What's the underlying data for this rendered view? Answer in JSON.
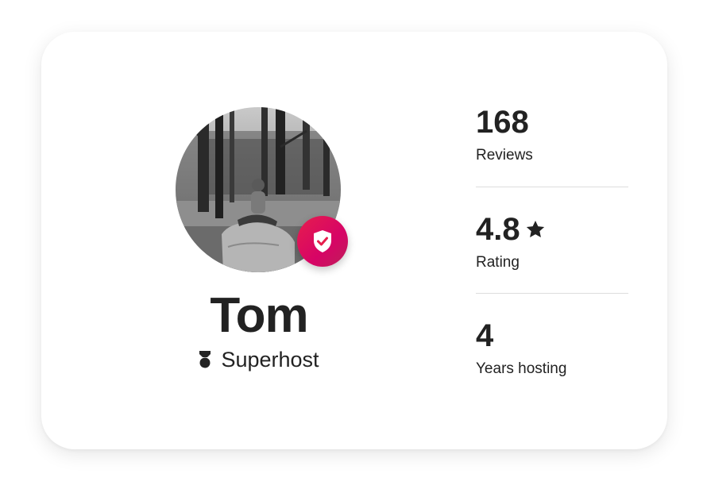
{
  "host": {
    "name": "Tom",
    "badge_label": "Superhost",
    "verified": true
  },
  "stats": [
    {
      "value": "168",
      "label": "Reviews"
    },
    {
      "value": "4.8",
      "label": "Rating",
      "icon": "star-icon"
    },
    {
      "value": "4",
      "label": "Years hosting"
    }
  ],
  "colors": {
    "accent": "#e61e4d",
    "accent_dark": "#bd1e59",
    "text": "#222222",
    "divider": "#dddddd"
  },
  "icons": {
    "verified_badge": "shield-check-icon",
    "superhost": "superhost-medal-icon",
    "rating": "star-icon"
  }
}
